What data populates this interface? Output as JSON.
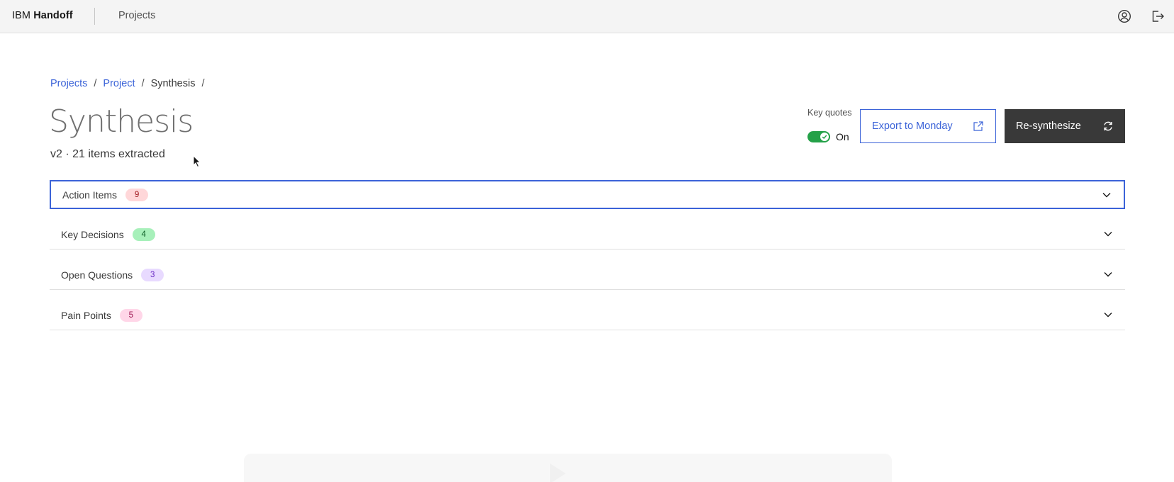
{
  "header": {
    "brand_prefix": "IBM",
    "brand_name": "Handoff",
    "nav_projects": "Projects",
    "icons": [
      "user-avatar-icon",
      "logout-icon"
    ]
  },
  "breadcrumb": {
    "items": [
      {
        "label": "Projects",
        "link": true
      },
      {
        "label": "Project",
        "link": true
      },
      {
        "label": "Synthesis",
        "link": false
      }
    ],
    "separator": "/"
  },
  "page": {
    "title": "Synthesis",
    "subtitle": "v2 · 21 items extracted"
  },
  "controls": {
    "toggle_label": "Key quotes",
    "toggle_state": "On",
    "toggle_on": true,
    "export_label": "Export to Monday",
    "resynth_label": "Re-synthesize"
  },
  "sections": [
    {
      "title": "Action Items",
      "count": "9",
      "tag_bg": "#ffd7d9",
      "tag_fg": "#a2191f"
    },
    {
      "title": "Key Decisions",
      "count": "4",
      "tag_bg": "#a7f0ba",
      "tag_fg": "#0e6027"
    },
    {
      "title": "Open Questions",
      "count": "3",
      "tag_bg": "#e8daff",
      "tag_fg": "#6929c4"
    },
    {
      "title": "Pain Points",
      "count": "5",
      "tag_bg": "#ffd6e8",
      "tag_fg": "#9f1853"
    }
  ],
  "colors": {
    "accent": "#3b63d8",
    "dark_button": "#393939",
    "toggle_on": "#24a148"
  }
}
